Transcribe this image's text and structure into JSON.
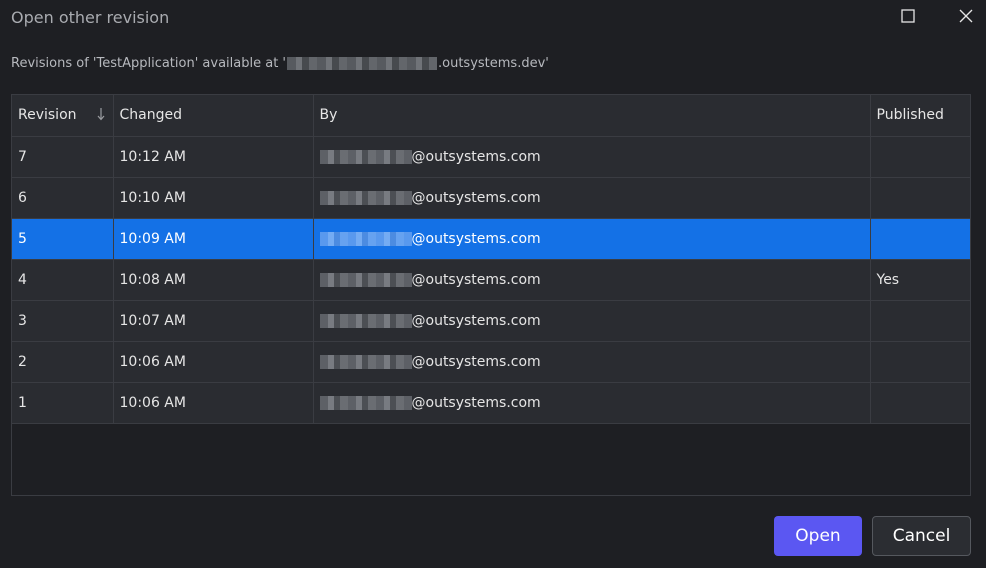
{
  "dialog": {
    "title": "Open other revision",
    "subtitle_prefix": "Revisions of 'TestApplication' available at '",
    "subtitle_suffix": ".outsystems.dev'"
  },
  "table": {
    "columns": [
      "Revision",
      "Changed",
      "By",
      "Published"
    ],
    "email_domain": "@outsystems.com",
    "rows": [
      {
        "revision": "7",
        "changed": "10:12 AM",
        "published": ""
      },
      {
        "revision": "6",
        "changed": "10:10 AM",
        "published": ""
      },
      {
        "revision": "5",
        "changed": "10:09 AM",
        "published": ""
      },
      {
        "revision": "4",
        "changed": "10:08 AM",
        "published": "Yes"
      },
      {
        "revision": "3",
        "changed": "10:07 AM",
        "published": ""
      },
      {
        "revision": "2",
        "changed": "10:06 AM",
        "published": ""
      },
      {
        "revision": "1",
        "changed": "10:06 AM",
        "published": ""
      }
    ],
    "selected_revision": "5"
  },
  "buttons": {
    "open": "Open",
    "cancel": "Cancel"
  },
  "icons": {
    "maximize": "maximize-icon",
    "close": "close-icon",
    "sort": "sort-descending-icon"
  },
  "colors": {
    "selection": "#1471e6",
    "primary_button": "#5b57f2"
  }
}
